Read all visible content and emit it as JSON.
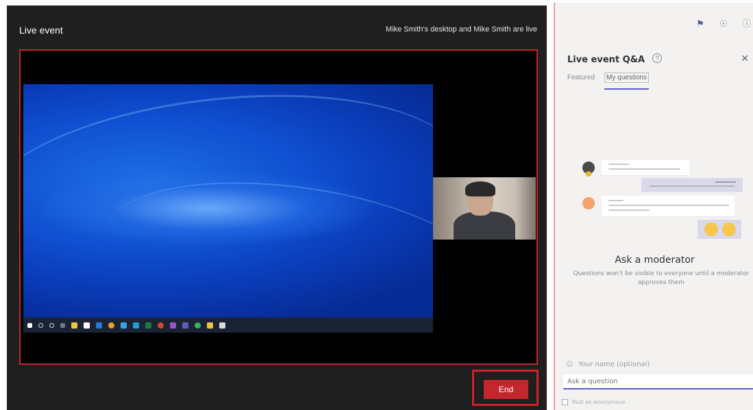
{
  "stage": {
    "title": "Live event",
    "status": "Mike Smith's desktop and Mike Smith are live",
    "end_label": "End",
    "colors": {
      "background": "#1f1f1f",
      "accent": "#c4262e"
    }
  },
  "panel": {
    "top_icons": [
      "flag-icon",
      "eye-icon",
      "info-icon"
    ],
    "qa_title": "Live event Q&A",
    "help_icon": "question-circle-icon",
    "close_icon": "close-icon",
    "tabs": [
      {
        "label": "Featured",
        "active": false
      },
      {
        "label": "My questions",
        "active": true
      }
    ],
    "empty_state": {
      "title": "Ask a moderator",
      "description": "Questions won't be visible to everyone until a moderator approves them"
    },
    "name_placeholder": "Your name (optional)",
    "question_placeholder": "Ask a question",
    "anonymous_label": "Post as anonymous",
    "colors": {
      "tab_underline": "#5b5fc7"
    }
  }
}
